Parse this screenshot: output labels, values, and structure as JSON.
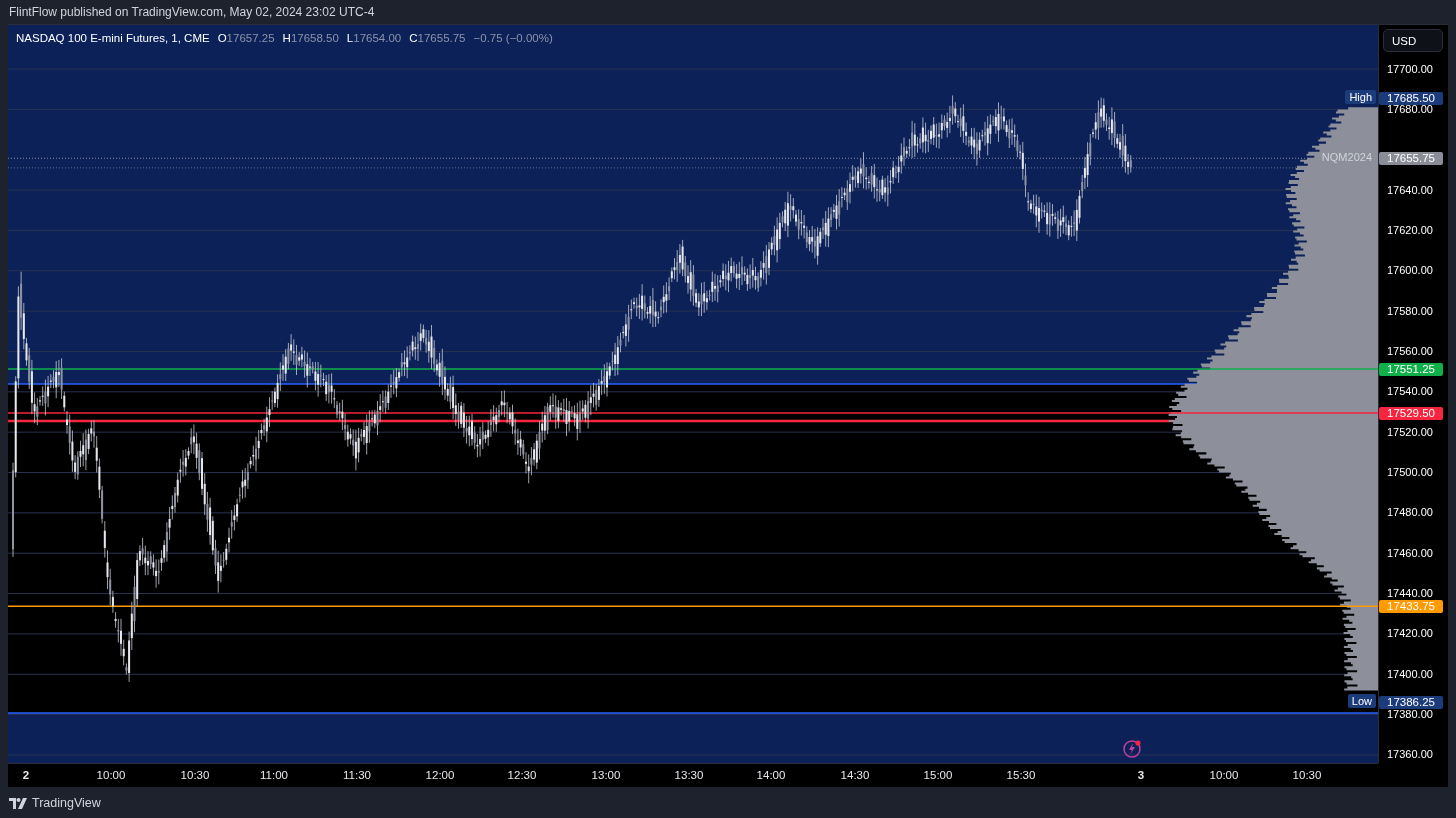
{
  "header": {
    "text": "FlintFlow published on TradingView.com, May 02, 2024 23:02 UTC-4"
  },
  "legend": {
    "symbol": "NASDAQ 100 E-mini Futures, 1, CME",
    "ohlc": [
      {
        "key": "O",
        "value": "17657.25"
      },
      {
        "key": "H",
        "value": "17658.50"
      },
      {
        "key": "L",
        "value": "17654.00"
      },
      {
        "key": "C",
        "value": "17655.75"
      }
    ],
    "change": "−0.75 (−0.00%)"
  },
  "currency_button": "USD",
  "price_axis": {
    "ticks": [
      "17700.00",
      "17680.00",
      "17640.00",
      "17620.00",
      "17600.00",
      "17580.00",
      "17560.00",
      "17540.00",
      "17520.00",
      "17500.00",
      "17480.00",
      "17460.00",
      "17440.00",
      "17420.00",
      "17400.00",
      "17380.00",
      "17360.00"
    ]
  },
  "price_markers": [
    {
      "kind": "extreme",
      "tag": "High",
      "value": "17685.50",
      "color": "#1c3b7a"
    },
    {
      "kind": "symbol",
      "tag": "NQM2024",
      "value": "17655.75",
      "color": "#8a8d95"
    },
    {
      "kind": "level",
      "value": "17551.25",
      "color": "#0fb04a"
    },
    {
      "kind": "level",
      "value": "17529.50",
      "color": "#f7253e"
    },
    {
      "kind": "level",
      "value": "17433.75",
      "color": "#ff9a00"
    },
    {
      "kind": "extreme",
      "tag": "Low",
      "value": "17386.25",
      "color": "#1c3b7a"
    }
  ],
  "time_axis": {
    "labels": [
      {
        "kind": "day",
        "text": "2"
      },
      {
        "kind": "time",
        "text": "10:00"
      },
      {
        "kind": "time",
        "text": "10:30"
      },
      {
        "kind": "time",
        "text": "11:00"
      },
      {
        "kind": "time",
        "text": "11:30"
      },
      {
        "kind": "time",
        "text": "12:00"
      },
      {
        "kind": "time",
        "text": "12:30"
      },
      {
        "kind": "time",
        "text": "13:00"
      },
      {
        "kind": "time",
        "text": "13:30"
      },
      {
        "kind": "time",
        "text": "14:00"
      },
      {
        "kind": "time",
        "text": "14:30"
      },
      {
        "kind": "time",
        "text": "15:00"
      },
      {
        "kind": "time",
        "text": "15:30"
      },
      {
        "kind": "day",
        "text": "3"
      },
      {
        "kind": "time",
        "text": "10:00"
      },
      {
        "kind": "time",
        "text": "10:30"
      }
    ]
  },
  "footer": {
    "brand": "TradingView"
  }
}
